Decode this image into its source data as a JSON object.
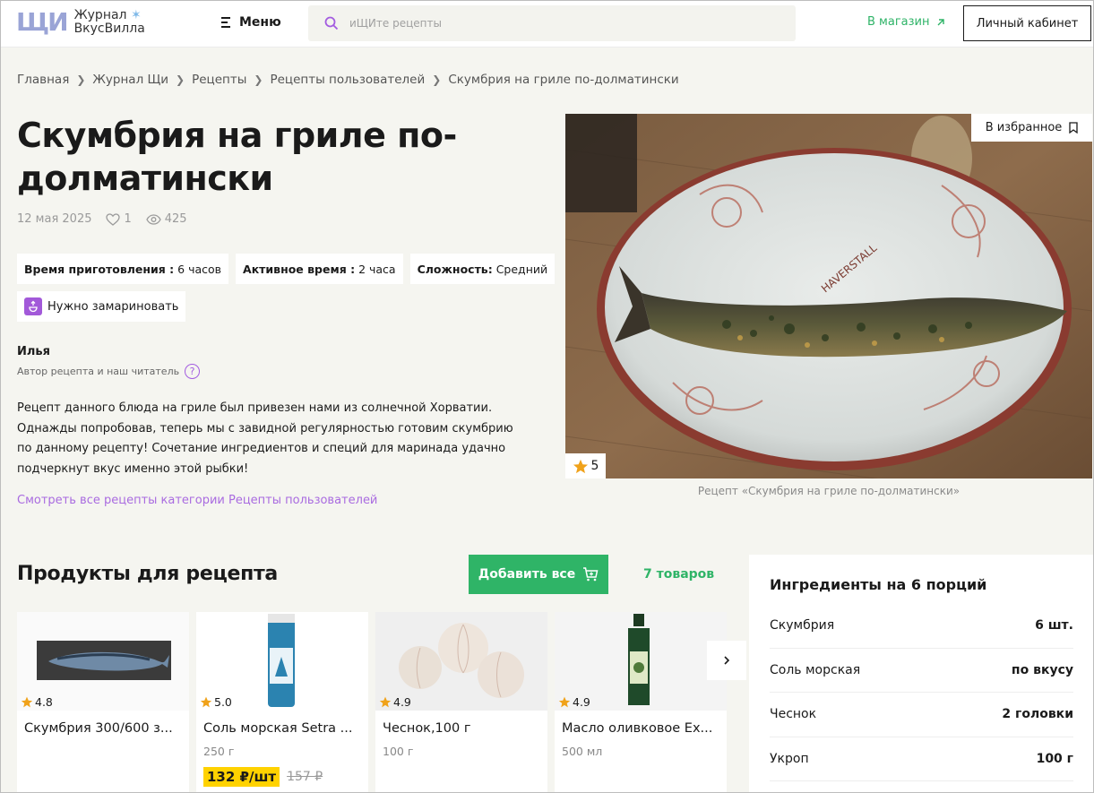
{
  "header": {
    "logo_mark": "ЩИ",
    "logo_line1": "Журнал",
    "logo_line2": "ВкусВилла",
    "menu_label": "Меню",
    "search_placeholder": "иЩИте рецепты",
    "shop_link": "В магазин",
    "cabinet_button": "Личный кабинет"
  },
  "breadcrumb": [
    "Главная",
    "Журнал Щи",
    "Рецепты",
    "Рецепты пользователей",
    "Скумбрия на гриле по-долматински"
  ],
  "recipe": {
    "title": "Скумбрия на гриле по-долматински",
    "date": "12 мая 2025",
    "likes": "1",
    "views": "425",
    "chips": [
      {
        "label": "Время приготовления :",
        "value": "6 часов"
      },
      {
        "label": "Активное время :",
        "value": "2 часа"
      },
      {
        "label": "Сложность:",
        "value": "Средний"
      }
    ],
    "marinate": "Нужно замариновать",
    "author_name": "Илья",
    "author_sub": "Автор рецепта и наш читатель",
    "author_help": "?",
    "description": "Рецепт данного блюда на гриле был привезен нами из солнечной Хорватии. Однажды попробовав, теперь мы с завидной регулярностью готовим скумбрию по данному рецепту! Сочетание ингредиентов и специй для маринада удачно подчеркнут вкус именно этой рыбки!",
    "category_link": "Смотреть все рецепты категории Рецепты пользователей",
    "favorite": "В избранное",
    "rating": "5",
    "photo_caption": "Рецепт «Скумбрия на гриле по-долматински»",
    "plate_text": "HAVERSTALL"
  },
  "products": {
    "title": "Продукты для рецепта",
    "add_all": "Добавить все",
    "count": "7 товаров",
    "items": [
      {
        "name": "Скумбрия 300/600 з...",
        "rating": "4.8",
        "weight": "",
        "price": "",
        "old_price": ""
      },
      {
        "name": "Соль морская Setra ...",
        "rating": "5.0",
        "weight": "250 г",
        "price": "132 ₽/шт",
        "old_price": "157 ₽"
      },
      {
        "name": "Чеснок,100 г",
        "rating": "4.9",
        "weight": "100 г",
        "price": "",
        "old_price": ""
      },
      {
        "name": "Масло оливковое Ex...",
        "rating": "4.9",
        "weight": "500 мл",
        "price": "",
        "old_price": ""
      }
    ]
  },
  "ingredients": {
    "title": "Ингредиенты на 6 порций",
    "rows": [
      {
        "name": "Скумбрия",
        "amount": "6 шт."
      },
      {
        "name": "Соль морская",
        "amount": "по вкусу"
      },
      {
        "name": "Чеснок",
        "amount": "2 головки"
      },
      {
        "name": "Укроп",
        "amount": "100 г"
      }
    ]
  },
  "colors": {
    "accent_green": "#2fb467",
    "accent_purple": "#a96be0",
    "price_yellow": "#ffd200",
    "star": "#f0a21a"
  }
}
